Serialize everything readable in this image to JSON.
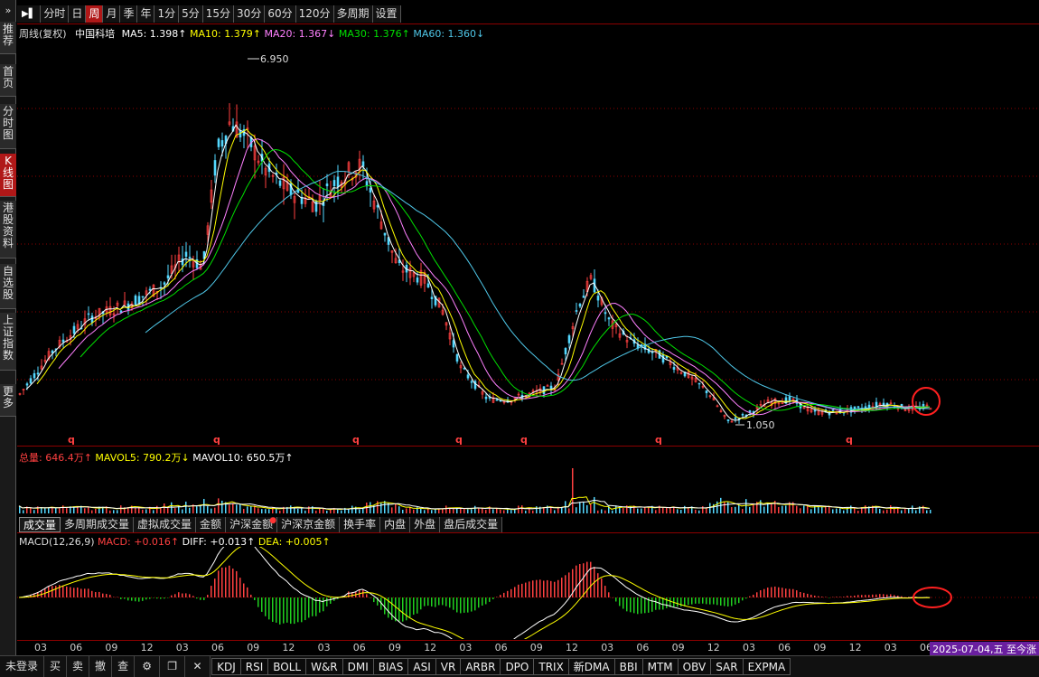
{
  "left_nav": {
    "arrow": "»",
    "items": [
      {
        "label": "推荐"
      },
      {
        "label": "首页"
      },
      {
        "label": "分时图"
      },
      {
        "label": "K线图",
        "active": true
      },
      {
        "label": "港股资料"
      },
      {
        "label": "自选股"
      },
      {
        "label": "上证指数"
      },
      {
        "label": "更多"
      }
    ]
  },
  "top_tabs": {
    "items": [
      "分时",
      "日",
      "周",
      "月",
      "季",
      "年",
      "1分",
      "5分",
      "15分",
      "30分",
      "60分",
      "120分",
      "多周期",
      "设置"
    ],
    "active": "周"
  },
  "main": {
    "legend": {
      "title": "周线(复权)",
      "stock": "中国科培",
      "ma5": "MA5: 1.398↑",
      "ma10": "MA10: 1.379↑",
      "ma20": "MA20: 1.367↓",
      "ma30": "MA30: 1.376↑",
      "ma60": "MA60: 1.360↓"
    },
    "high_label": "6.950",
    "low_label": "1.050",
    "q_marker": "q"
  },
  "volume": {
    "legend": {
      "total": "总量: 646.4万↑",
      "mavol5": "MAVOL5: 790.2万↓",
      "mavol10": "MAVOL10: 650.5万↑"
    },
    "tabs": [
      "成交量",
      "多周期成交量",
      "虚拟成交量",
      "金额",
      "沪深金额",
      "沪深京金额",
      "换手率",
      "内盘",
      "外盘",
      "盘后成交量"
    ],
    "active_tab": "成交量"
  },
  "macd": {
    "legend": {
      "title": "MACD(12,26,9)",
      "macd": "MACD: +0.016↑",
      "diff": "DIFF: +0.013↑",
      "dea": "DEA: +0.005↑"
    }
  },
  "x_axis": {
    "labels": [
      "03",
      "06",
      "09",
      "12",
      "03",
      "06",
      "09",
      "12",
      "03",
      "06",
      "09",
      "12",
      "03",
      "06",
      "09",
      "12",
      "03",
      "06",
      "09",
      "12",
      "03",
      "06",
      "09",
      "12",
      "03",
      "06"
    ]
  },
  "date_box": "2025-07-04,五 至今涨",
  "bottom_bar": {
    "buttons": [
      "未登录",
      "买",
      "卖",
      "撤",
      "查"
    ],
    "icons": [
      "gear-icon",
      "window-icon",
      "close-icon"
    ],
    "indicators": [
      "KDJ",
      "RSI",
      "BOLL",
      "W&R",
      "DMI",
      "BIAS",
      "ASI",
      "VR",
      "ARBR",
      "DPO",
      "TRIX",
      "新DMA",
      "BBI",
      "MTM",
      "OBV",
      "SAR",
      "EXPMA"
    ]
  },
  "colors": {
    "up": "#ff4040",
    "down": "#54d8ff",
    "ma5": "#ffffff",
    "ma10": "#ffff00",
    "ma20": "#ff80ff",
    "ma30": "#00e000",
    "ma60": "#4fc7e8",
    "grid": "#8c0000",
    "active_tab": "#b01818",
    "highlight_circle": "#ff2020"
  }
}
